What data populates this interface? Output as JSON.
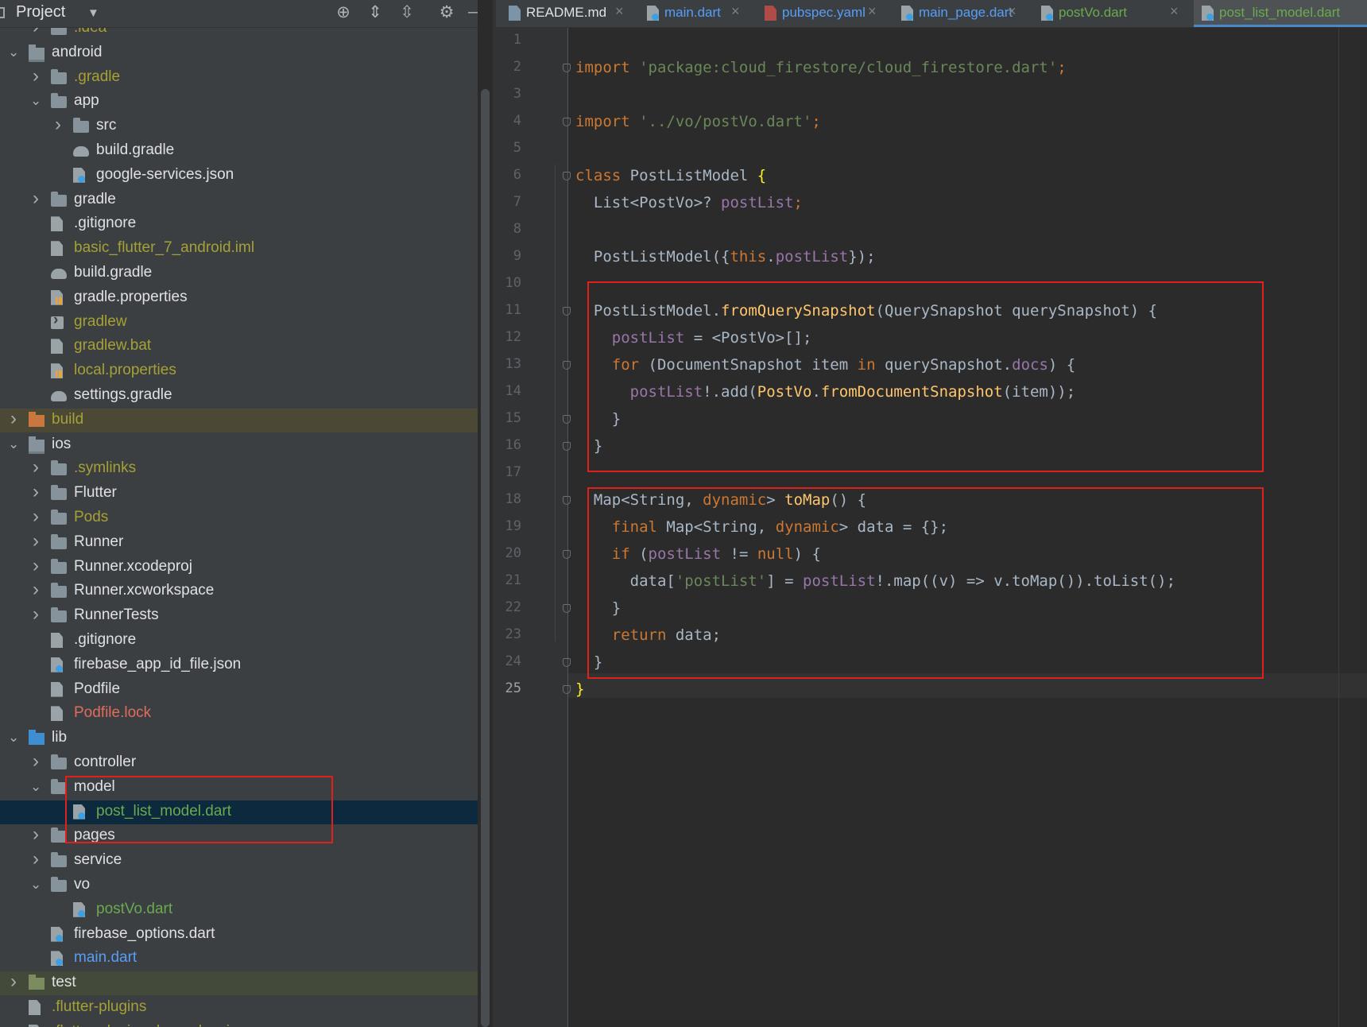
{
  "project_panel": {
    "title": "Project",
    "tree": [
      {
        "label": ".idea",
        "indent": 1,
        "icon": "folder-icon",
        "color": "olive",
        "arrow": "right"
      },
      {
        "label": "android",
        "indent": 0,
        "icon": "module-folder-icon",
        "color": "white",
        "arrow": "down"
      },
      {
        "label": ".gradle",
        "indent": 1,
        "icon": "folder-icon",
        "color": "olive",
        "arrow": "right"
      },
      {
        "label": "app",
        "indent": 1,
        "icon": "folder-icon",
        "color": "white",
        "arrow": "down"
      },
      {
        "label": "src",
        "indent": 2,
        "icon": "folder-icon",
        "color": "white",
        "arrow": "right"
      },
      {
        "label": "build.gradle",
        "indent": 2,
        "icon": "gradle-icon",
        "color": "white"
      },
      {
        "label": "google-services.json",
        "indent": 2,
        "icon": "json-file-icon",
        "color": "white"
      },
      {
        "label": "gradle",
        "indent": 1,
        "icon": "folder-icon",
        "color": "white",
        "arrow": "right"
      },
      {
        "label": ".gitignore",
        "indent": 1,
        "icon": "gitignore-file-icon",
        "color": "white"
      },
      {
        "label": "basic_flutter_7_android.iml",
        "indent": 1,
        "icon": "iml-file-icon",
        "color": "olive"
      },
      {
        "label": "build.gradle",
        "indent": 1,
        "icon": "gradle-icon",
        "color": "white"
      },
      {
        "label": "gradle.properties",
        "indent": 1,
        "icon": "properties-file-icon",
        "color": "white"
      },
      {
        "label": "gradlew",
        "indent": 1,
        "icon": "terminal-file-icon",
        "color": "olive"
      },
      {
        "label": "gradlew.bat",
        "indent": 1,
        "icon": "text-file-icon",
        "color": "olive"
      },
      {
        "label": "local.properties",
        "indent": 1,
        "icon": "properties-file-icon",
        "color": "olive"
      },
      {
        "label": "settings.gradle",
        "indent": 1,
        "icon": "gradle-icon",
        "color": "white"
      },
      {
        "label": "build",
        "indent": 0,
        "icon": "build-folder-icon",
        "color": "olive",
        "arrow": "right",
        "shade": "build"
      },
      {
        "label": "ios",
        "indent": 0,
        "icon": "module-folder-icon",
        "color": "white",
        "arrow": "down"
      },
      {
        "label": ".symlinks",
        "indent": 1,
        "icon": "folder-icon",
        "color": "olive",
        "arrow": "right"
      },
      {
        "label": "Flutter",
        "indent": 1,
        "icon": "folder-icon",
        "color": "white",
        "arrow": "right"
      },
      {
        "label": "Pods",
        "indent": 1,
        "icon": "folder-icon",
        "color": "olive",
        "arrow": "right"
      },
      {
        "label": "Runner",
        "indent": 1,
        "icon": "folder-icon",
        "color": "white",
        "arrow": "right"
      },
      {
        "label": "Runner.xcodeproj",
        "indent": 1,
        "icon": "folder-icon",
        "color": "white",
        "arrow": "right"
      },
      {
        "label": "Runner.xcworkspace",
        "indent": 1,
        "icon": "folder-icon",
        "color": "white",
        "arrow": "right"
      },
      {
        "label": "RunnerTests",
        "indent": 1,
        "icon": "folder-icon",
        "color": "white",
        "arrow": "right"
      },
      {
        "label": ".gitignore",
        "indent": 1,
        "icon": "gitignore-file-icon",
        "color": "white"
      },
      {
        "label": "firebase_app_id_file.json",
        "indent": 1,
        "icon": "json-file-icon",
        "color": "white"
      },
      {
        "label": "Podfile",
        "indent": 1,
        "icon": "text-file-icon",
        "color": "white"
      },
      {
        "label": "Podfile.lock",
        "indent": 1,
        "icon": "text-file-icon",
        "color": "red"
      },
      {
        "label": "lib",
        "indent": 0,
        "icon": "source-folder-icon",
        "color": "white",
        "arrow": "down"
      },
      {
        "label": "controller",
        "indent": 1,
        "icon": "folder-icon",
        "color": "white",
        "arrow": "right"
      },
      {
        "label": "model",
        "indent": 1,
        "icon": "folder-icon",
        "color": "white",
        "arrow": "down"
      },
      {
        "label": "post_list_model.dart",
        "indent": 2,
        "icon": "dart-file-icon",
        "color": "green",
        "selected": true
      },
      {
        "label": "pages",
        "indent": 1,
        "icon": "folder-icon",
        "color": "white",
        "arrow": "right"
      },
      {
        "label": "service",
        "indent": 1,
        "icon": "folder-icon",
        "color": "white",
        "arrow": "right"
      },
      {
        "label": "vo",
        "indent": 1,
        "icon": "folder-icon",
        "color": "white",
        "arrow": "down"
      },
      {
        "label": "postVo.dart",
        "indent": 2,
        "icon": "dart-file-icon",
        "color": "green"
      },
      {
        "label": "firebase_options.dart",
        "indent": 1,
        "icon": "dart-file-icon",
        "color": "white"
      },
      {
        "label": "main.dart",
        "indent": 1,
        "icon": "dart-file-icon",
        "color": "blue"
      },
      {
        "label": "test",
        "indent": 0,
        "icon": "test-folder-icon",
        "color": "white",
        "arrow": "right",
        "shade": "test"
      },
      {
        "label": ".flutter-plugins",
        "indent": 0,
        "icon": "text-file-icon",
        "color": "olive"
      },
      {
        "label": ".flutter-plugins-dependencies",
        "indent": 0,
        "icon": "text-file-icon",
        "color": "olive"
      }
    ]
  },
  "tabs": [
    {
      "label": "README.md",
      "icon": "markdown-file-icon",
      "color": "#dfe1e5",
      "active": false
    },
    {
      "label": "main.dart",
      "icon": "dart-file-icon",
      "color": "#589df6",
      "active": false
    },
    {
      "label": "pubspec.yaml",
      "icon": "yaml-file-icon",
      "color": "#589df6",
      "active": false
    },
    {
      "label": "main_page.dart",
      "icon": "dart-file-icon",
      "color": "#589df6",
      "active": false
    },
    {
      "label": "postVo.dart",
      "icon": "dart-file-icon",
      "color": "#6aaa4f",
      "active": false
    },
    {
      "label": "post_list_model.dart",
      "icon": "dart-file-icon",
      "color": "#6aaa4f",
      "active": true
    }
  ],
  "editor": {
    "current_line": 25,
    "lines": [
      {
        "n": "1",
        "tokens": []
      },
      {
        "n": "2",
        "tokens": [
          {
            "t": "import ",
            "c": "k"
          },
          {
            "t": "'package:cloud_firestore/cloud_firestore.dart'",
            "c": "s"
          },
          {
            "t": ";",
            "c": "k"
          }
        ]
      },
      {
        "n": "3",
        "tokens": []
      },
      {
        "n": "4",
        "tokens": [
          {
            "t": "import ",
            "c": "k"
          },
          {
            "t": "'../vo/postVo.dart'",
            "c": "s"
          },
          {
            "t": ";",
            "c": "k"
          }
        ]
      },
      {
        "n": "5",
        "tokens": []
      },
      {
        "n": "6",
        "tokens": [
          {
            "t": "class ",
            "c": "k"
          },
          {
            "t": "PostListModel ",
            "c": ""
          },
          {
            "t": "{",
            "c": "y"
          }
        ]
      },
      {
        "n": "7",
        "tokens": [
          {
            "t": "  List<PostVo>? ",
            "c": ""
          },
          {
            "t": "postList",
            "c": "p"
          },
          {
            "t": ";",
            "c": "k"
          }
        ]
      },
      {
        "n": "8",
        "tokens": []
      },
      {
        "n": "9",
        "tokens": [
          {
            "t": "  PostListModel({",
            "c": ""
          },
          {
            "t": "this",
            "c": "k"
          },
          {
            "t": ".",
            "c": ""
          },
          {
            "t": "postList",
            "c": "p"
          },
          {
            "t": "});",
            "c": ""
          }
        ]
      },
      {
        "n": "10",
        "tokens": []
      },
      {
        "n": "11",
        "tokens": [
          {
            "t": "  PostListModel.",
            "c": ""
          },
          {
            "t": "fromQuerySnapshot",
            "c": "f"
          },
          {
            "t": "(QuerySnapshot querySnapshot) {",
            "c": ""
          }
        ]
      },
      {
        "n": "12",
        "tokens": [
          {
            "t": "    ",
            "c": ""
          },
          {
            "t": "postList",
            "c": "p"
          },
          {
            "t": " = <PostVo>[];",
            "c": ""
          }
        ]
      },
      {
        "n": "13",
        "tokens": [
          {
            "t": "    ",
            "c": ""
          },
          {
            "t": "for ",
            "c": "k"
          },
          {
            "t": "(DocumentSnapshot item ",
            "c": ""
          },
          {
            "t": "in ",
            "c": "k"
          },
          {
            "t": "querySnapshot.",
            "c": ""
          },
          {
            "t": "docs",
            "c": "p"
          },
          {
            "t": ") {",
            "c": ""
          }
        ]
      },
      {
        "n": "14",
        "tokens": [
          {
            "t": "      ",
            "c": ""
          },
          {
            "t": "postList",
            "c": "p"
          },
          {
            "t": "!.add(",
            "c": ""
          },
          {
            "t": "PostVo",
            "c": "f"
          },
          {
            "t": ".",
            "c": ""
          },
          {
            "t": "fromDocumentSnapshot",
            "c": "f"
          },
          {
            "t": "(item));",
            "c": ""
          }
        ]
      },
      {
        "n": "15",
        "tokens": [
          {
            "t": "    }",
            "c": ""
          }
        ]
      },
      {
        "n": "16",
        "tokens": [
          {
            "t": "  }",
            "c": ""
          }
        ]
      },
      {
        "n": "17",
        "tokens": []
      },
      {
        "n": "18",
        "tokens": [
          {
            "t": "  Map<String, ",
            "c": ""
          },
          {
            "t": "dynamic",
            "c": "k"
          },
          {
            "t": "> ",
            "c": ""
          },
          {
            "t": "toMap",
            "c": "f"
          },
          {
            "t": "() {",
            "c": ""
          }
        ]
      },
      {
        "n": "19",
        "tokens": [
          {
            "t": "    ",
            "c": ""
          },
          {
            "t": "final ",
            "c": "k"
          },
          {
            "t": "Map<String, ",
            "c": ""
          },
          {
            "t": "dynamic",
            "c": "k"
          },
          {
            "t": "> data = {};",
            "c": ""
          }
        ]
      },
      {
        "n": "20",
        "tokens": [
          {
            "t": "    ",
            "c": ""
          },
          {
            "t": "if ",
            "c": "k"
          },
          {
            "t": "(",
            "c": ""
          },
          {
            "t": "postList",
            "c": "p"
          },
          {
            "t": " != ",
            "c": ""
          },
          {
            "t": "null",
            "c": "k"
          },
          {
            "t": ") {",
            "c": ""
          }
        ]
      },
      {
        "n": "21",
        "tokens": [
          {
            "t": "      data[",
            "c": ""
          },
          {
            "t": "'postList'",
            "c": "s"
          },
          {
            "t": "] = ",
            "c": ""
          },
          {
            "t": "postList",
            "c": "p"
          },
          {
            "t": "!.map((v) => v.toMap()).toList();",
            "c": ""
          }
        ]
      },
      {
        "n": "22",
        "tokens": [
          {
            "t": "    }",
            "c": ""
          }
        ]
      },
      {
        "n": "23",
        "tokens": [
          {
            "t": "    ",
            "c": ""
          },
          {
            "t": "return ",
            "c": "k"
          },
          {
            "t": "data;",
            "c": ""
          }
        ]
      },
      {
        "n": "24",
        "tokens": [
          {
            "t": "  }",
            "c": ""
          }
        ]
      },
      {
        "n": "25",
        "tokens": [
          {
            "t": "}",
            "c": "y"
          }
        ]
      }
    ]
  },
  "colors": {
    "highlight_box": "#e0201b",
    "selection": "#0d293e",
    "keyword": "#cc7832",
    "string": "#6a8759",
    "function": "#ffc66d",
    "field": "#9876aa"
  }
}
